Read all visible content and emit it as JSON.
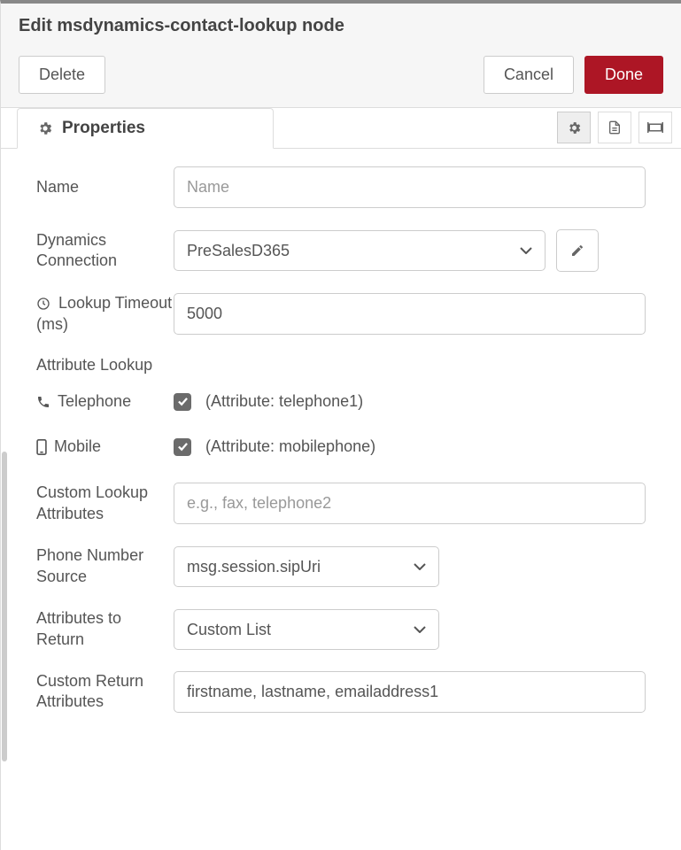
{
  "title": "Edit msdynamics-contact-lookup node",
  "buttons": {
    "delete": "Delete",
    "cancel": "Cancel",
    "done": "Done"
  },
  "tabs": {
    "properties": "Properties"
  },
  "form": {
    "name_label": "Name",
    "name_placeholder": "Name",
    "name_value": "",
    "connection_label": "Dynamics Connection",
    "connection_value": "PreSalesD365",
    "timeout_label": "Lookup Timeout (ms)",
    "timeout_value": "5000",
    "attribute_lookup_header": "Attribute Lookup",
    "telephone_label": "Telephone",
    "telephone_attr": "(Attribute: telephone1)",
    "mobile_label": "Mobile",
    "mobile_attr": "(Attribute: mobilephone)",
    "custom_lookup_label": "Custom Lookup Attributes",
    "custom_lookup_placeholder": "e.g., fax, telephone2",
    "custom_lookup_value": "",
    "phone_source_label": "Phone Number Source",
    "phone_source_value": "msg.session.sipUri",
    "attrs_return_label": "Attributes to Return",
    "attrs_return_value": "Custom List",
    "custom_return_label": "Custom Return Attributes",
    "custom_return_value": "firstname, lastname, emailaddress1"
  }
}
